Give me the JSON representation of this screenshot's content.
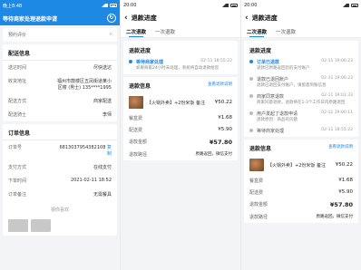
{
  "screen1": {
    "status_time": "晚上8:48",
    "title": "等待商家处理退款申请",
    "rows_top": [
      {
        "label": "预约评价",
        "value": ""
      }
    ],
    "section_delivery": "配送信息",
    "delivery_rows": [
      {
        "label": "送达时间",
        "value": "尽快送达"
      },
      {
        "label": "收货地址",
        "value": "福州市鼓楼区五凤街道某小区楼 (男士) 135****1995"
      },
      {
        "label": "配送方式",
        "value": "商家配送"
      },
      {
        "label": "配送骑士",
        "value": "李师"
      }
    ],
    "section_order": "订单信息",
    "order_rows": [
      {
        "label": "订单号",
        "value": "6813037954382108",
        "action": "复制"
      },
      {
        "label": "支付方式",
        "value": "在线支付"
      },
      {
        "label": "下单时间",
        "value": "2021-02-11 18:52"
      },
      {
        "label": "订单备注",
        "value": "无需餐具"
      }
    ],
    "bottom_note": "猜你喜欢"
  },
  "screen2": {
    "status_time": "20:00",
    "nav_title": "退款进度",
    "tabs": [
      "二次退款",
      "一次退款"
    ],
    "progress_title": "退款进度",
    "steps": [
      {
        "title": "等待商家处理",
        "time": "02-11 18:55:22",
        "desc": "如果商家24小时未处理，系统将自动退款给您"
      }
    ],
    "info_title": "退款信息",
    "info_link": "查看退款说明",
    "goods": {
      "name": "【火锅外卖】+2份米饭",
      "tag": "备注",
      "price": "¥50.22"
    },
    "money_rows": [
      {
        "label": "餐盒费",
        "value": "¥1.68"
      },
      {
        "label": "配送费",
        "value": "¥5.90"
      }
    ],
    "refund_total": {
      "label": "退款金额",
      "value": "¥57.80"
    },
    "refund_route": {
      "label": "退款路径",
      "value": "原路返回，微信支付"
    }
  },
  "screen3": {
    "status_time": "20:00",
    "nav_title": "退款进度",
    "tabs": [
      "二次退款",
      "一次退款"
    ],
    "progress_title": "退款进度",
    "steps": [
      {
        "title": "订单已退款",
        "time": "02-11 19:06:23",
        "desc": "退款已原路返回您的支付账户",
        "active": true
      },
      {
        "title": "退款已退回账户",
        "time": "02-11 19:06:23",
        "desc": "退款已退回支付账户，请留意到账信息",
        "active": false
      },
      {
        "title": "商家同意退款",
        "time": "02-11 19:01:33",
        "desc": "商家同意退款，退款将在1-3个工作日内原路退回",
        "active": false
      },
      {
        "title": "用户发起了退款申请",
        "time": "02-11 19:00:11",
        "desc": "退款原因：商品有问题",
        "active": false
      },
      {
        "title": "等待商家处理",
        "time": "02-11 18:55:22",
        "desc": "",
        "active": false
      }
    ],
    "info_title": "退款信息",
    "info_link": "查看退款说明",
    "goods": {
      "name": "【火锅外卖】+2份米饭",
      "tag": "备注",
      "price": "¥50.22"
    },
    "money_rows": [
      {
        "label": "餐盒费",
        "value": "¥1.68"
      },
      {
        "label": "配送费",
        "value": "¥5.90"
      }
    ],
    "refund_total": {
      "label": "退款金额",
      "value": "¥57.80"
    },
    "refund_route": {
      "label": "退款路径",
      "value": "原路返回，微信支付"
    }
  },
  "colors": {
    "accent": "#1e88e5",
    "background": "#f3f4f6"
  }
}
